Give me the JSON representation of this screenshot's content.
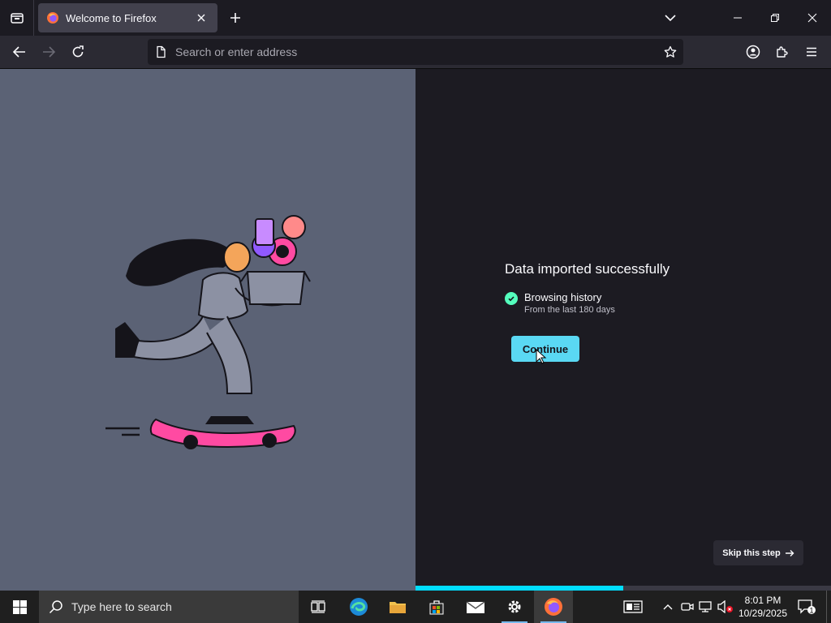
{
  "browser": {
    "tab": {
      "title": "Welcome to Firefox"
    },
    "urlbar": {
      "placeholder": "Search or enter address"
    }
  },
  "onboarding": {
    "title": "Data imported successfully",
    "items": [
      {
        "label": "Browsing history",
        "sub": "From the last 180 days"
      }
    ],
    "continue_label": "Continue",
    "skip_label": "Skip this step",
    "progress": 0.5
  },
  "taskbar": {
    "search_placeholder": "Type here to search",
    "time": "8:01 PM",
    "date": "10/29/2025",
    "notification_count": "1"
  },
  "colors": {
    "accent": "#00ddff",
    "illustration_bg": "#5b6275",
    "dark_bg": "#1c1b22"
  }
}
